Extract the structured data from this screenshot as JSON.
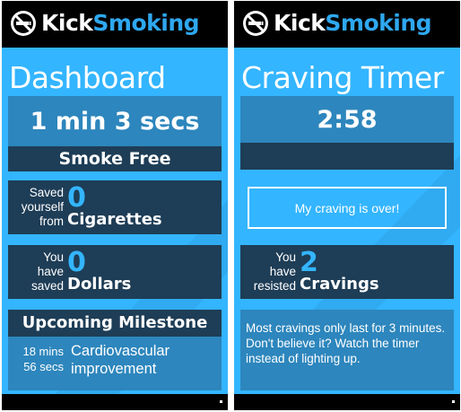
{
  "app": {
    "name_kick": "Kick",
    "name_smoking": "Smoking",
    "accent": "#33b5ff",
    "dark_panel": "#1e3d56"
  },
  "dashboard": {
    "title": "Dashboard",
    "smoke_free_time": "1 min 3 secs",
    "smoke_free_label": "Smoke Free",
    "cigarettes": {
      "prefix_lines": [
        "Saved",
        "yourself",
        "from"
      ],
      "value": "0",
      "unit": "Cigarettes"
    },
    "dollars": {
      "prefix_lines": [
        "You",
        "have",
        "saved"
      ],
      "value": "0",
      "unit": "Dollars"
    },
    "milestone": {
      "title": "Upcoming Milestone",
      "when_lines": [
        "18 mins",
        "56 secs"
      ],
      "what_lines": [
        "Cardiovascular",
        "improvement"
      ]
    }
  },
  "craving": {
    "title": "Craving Timer",
    "timer": "2:58",
    "button_label": "My craving is over!",
    "resisted": {
      "prefix_lines": [
        "You",
        "have",
        "resisted"
      ],
      "value": "2",
      "unit": "Cravings"
    },
    "tip": "Most cravings only last for 3 minutes. Don't believe it? Watch the timer instead of lighting up."
  },
  "icons": {
    "logo": "no-smoking-icon",
    "app_bar_more": "ellipsis-icon"
  }
}
